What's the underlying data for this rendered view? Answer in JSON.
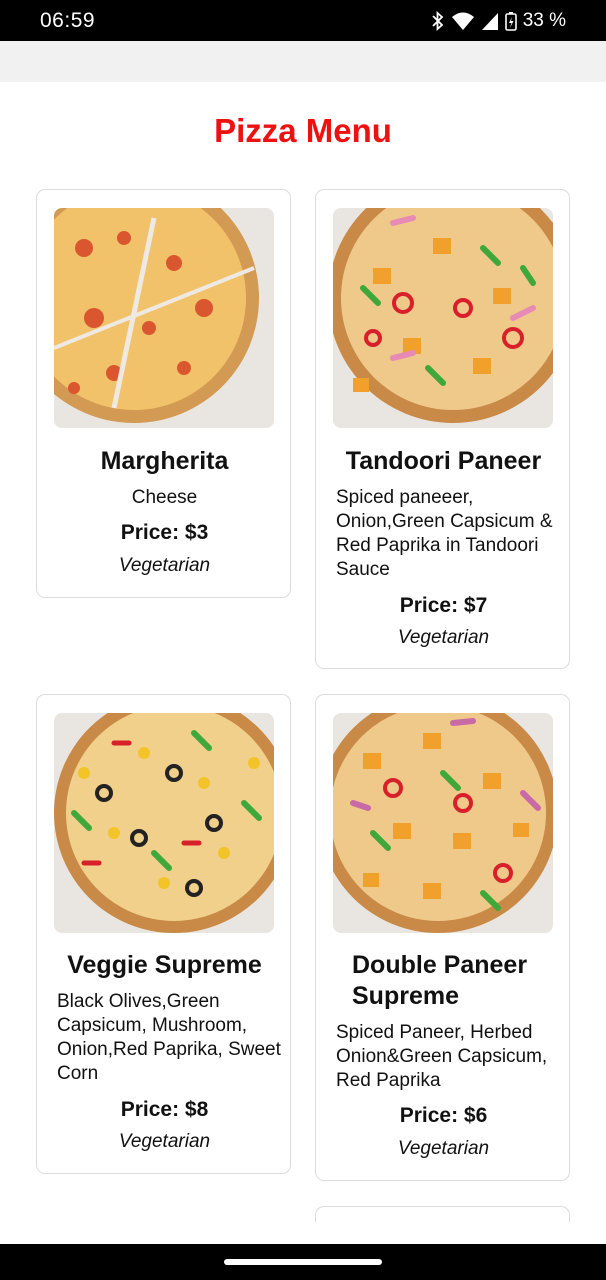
{
  "status_bar": {
    "time": "06:59",
    "battery": "33 %",
    "icons": [
      "bluetooth-icon",
      "wifi-icon",
      "signal-icon",
      "battery-icon"
    ]
  },
  "page": {
    "title": "Pizza Menu",
    "title_color": "#ee1111"
  },
  "pizzas": [
    {
      "name": "Margherita",
      "description": "Cheese",
      "price": "Price: $3",
      "type": "Vegetarian",
      "image": "margherita-pizza-photo"
    },
    {
      "name": "Tandoori Paneer",
      "description": "Spiced paneeer, Onion,Green Capsicum & Red Paprika in Tandoori Sauce",
      "price": "Price: $7",
      "type": "Vegetarian",
      "image": "tandoori-paneer-pizza-photo"
    },
    {
      "name": "Veggie Supreme",
      "description": "Black Olives,Green Capsicum, Mushroom, Onion,Red Paprika, Sweet Corn",
      "price": "Price: $8",
      "type": "Vegetarian",
      "image": "veggie-supreme-pizza-photo"
    },
    {
      "name": "Double Paneer Supreme",
      "description": "Spiced Paneer, Herbed Onion&Green Capsicum, Red Paprika",
      "price": "Price: $6",
      "type": "Vegetarian",
      "image": "double-paneer-supreme-pizza-photo"
    }
  ]
}
